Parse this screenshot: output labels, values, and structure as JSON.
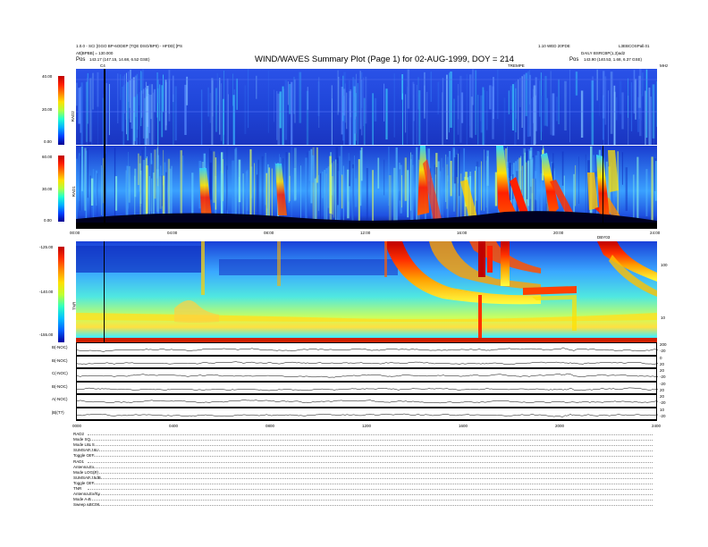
{
  "header": {
    "title": "WIND/WAVES Summary Plot (Page 1) for 02-AUG-1999, DOY = 214",
    "left_line1": "1.0.0 - SCI [GGO BP-6ODEP (TQE DSO/BP0) - HFDD] [PS",
    "left_line2": "Att[BPBB] = 130.000",
    "pos_label": "Pos",
    "pos_value": "143.17 (147.15, 14.68, 6.52 GSE)",
    "right_line1": "1.10 WED 20FDE",
    "right_line2": "DAILY BSRCBP(1,3)ad2",
    "right_pos_label": "Pos",
    "right_pos_value": "143.90 (140.53, 1.68, 6.37 GSE)",
    "corner": "L3EBCOSPall.01",
    "marker_left": "C4",
    "marker_right": "TREMPE",
    "mhz": "MHz"
  },
  "chart_data": [
    {
      "type": "heatmap",
      "name": "RAD2",
      "ylabel": "RAD2",
      "colorbar_ticks": [
        "40.00",
        "20.00",
        "0.00"
      ],
      "colorbar_range": [
        0,
        40
      ],
      "note": "dynamic spectrum, intensity in dB above background"
    },
    {
      "type": "heatmap",
      "name": "RAD1",
      "ylabel": "RAD1",
      "colorbar_ticks": [
        "60.00",
        "30.00",
        "0.00"
      ],
      "colorbar_range": [
        0,
        60
      ]
    },
    {
      "type": "heatmap",
      "name": "TNR",
      "ylabel": "TNR",
      "colorbar_ticks": [
        "-125.00",
        "-140.00",
        "-155.00"
      ],
      "colorbar_range": [
        -155,
        -125
      ],
      "right_ticks": [
        "100",
        "10"
      ]
    },
    {
      "type": "line",
      "name": "magnetic field",
      "series": [
        {
          "name": "B(-NOC)",
          "right_tick": "200"
        },
        {
          "name": "B(-NOC)",
          "right_tick": "0"
        },
        {
          "name": "C(-NOC)",
          "right_tick": "20"
        },
        {
          "name": "B(-NOC)",
          "right_tick": "-20"
        },
        {
          "name": "A(-NOC)",
          "right_tick": "20"
        },
        {
          "name": "|B|(T?)",
          "right_tick": "10"
        }
      ],
      "right_ticks_extra": [
        "-20",
        "20",
        "-20",
        "20",
        "-20",
        "-20"
      ]
    }
  ],
  "time_axis": {
    "ticks_upper": [
      "00:00",
      "04:00",
      "08:00",
      "12:00",
      "16:00",
      "20:00",
      "24:00"
    ],
    "ticks_lower": [
      "0000",
      "0400",
      "0800",
      "1200",
      "1600",
      "2000",
      "2400"
    ],
    "mark": "DBY03"
  },
  "footer": [
    {
      "label": "RAD2",
      "value": ""
    },
    {
      "label": "Mode",
      "value": "SQ"
    },
    {
      "label": "Mode",
      "value": "LIN S"
    },
    {
      "label": "SUMSAP",
      "value": "16U"
    },
    {
      "label": "Toggle",
      "value": "OFF"
    },
    {
      "label": "RAD1",
      "value": ""
    },
    {
      "label": "Antenna",
      "value": "Ex"
    },
    {
      "label": "Mode",
      "value": "LOG(P)"
    },
    {
      "label": "SUMSAP",
      "value": "15dB"
    },
    {
      "label": "Toggle",
      "value": "OFF"
    },
    {
      "label": "TNR",
      "value": ""
    },
    {
      "label": "Antenna",
      "value": "Ex/Ey"
    },
    {
      "label": "Mode",
      "value": "A-B"
    },
    {
      "label": "Sweep",
      "value": "ABC08"
    }
  ],
  "colors": {
    "background_blue": "#1f3fd8",
    "deep_blue": "#0a1aa0",
    "hot": "#ff2000"
  }
}
